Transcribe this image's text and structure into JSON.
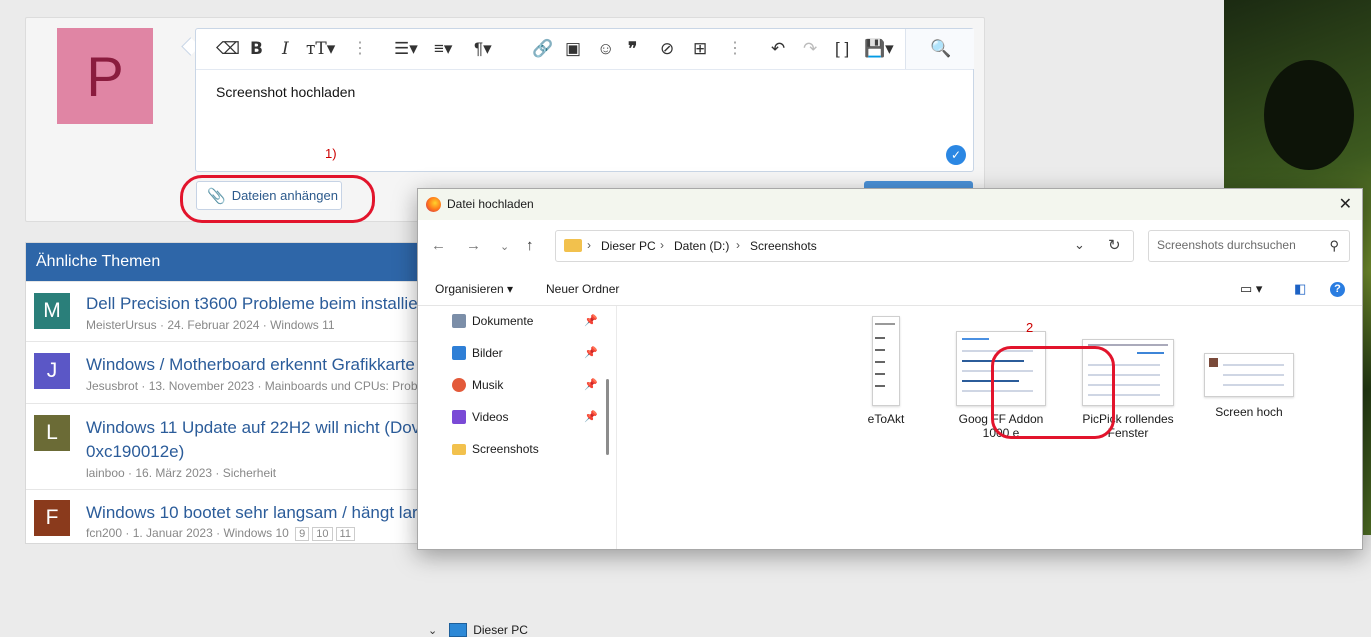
{
  "composer": {
    "avatar_letter": "P",
    "editor_text": "Screenshot hochladen",
    "toolbar_icons": [
      "eraser-icon",
      "bold-icon",
      "italic-icon",
      "text-size-icon",
      "more-icon",
      "list-icon",
      "align-icon",
      "paragraph-icon",
      "more-icon",
      "link-icon",
      "image-icon",
      "smiley-icon",
      "quote-icon",
      "hide-icon",
      "table-icon",
      "more-icon",
      "undo-icon",
      "redo-icon",
      "code-icon",
      "save-draft-icon",
      "preview-icon"
    ],
    "step1_label": "1)",
    "attach_label": "Dateien anhängen"
  },
  "similar": {
    "heading": "Ähnliche Themen",
    "topics": [
      {
        "letter": "M",
        "color": "#2a7f7a",
        "title": "Dell Precision t3600 Probleme beim installier",
        "author": "MeisterUrsus",
        "date": "24. Februar 2024",
        "forum": "Windows 11"
      },
      {
        "letter": "J",
        "color": "#5b57c6",
        "title": "Windows / Motherboard erkennt Grafikkarte",
        "author": "Jesusbrot",
        "date": "13. November 2023",
        "forum": "Mainboards und CPUs: Problen"
      },
      {
        "letter": "L",
        "color": "#6b6b36",
        "title": "Windows 11 Update auf 22H2 will nicht (Dov",
        "title2": "0xc190012e)",
        "author": "lainboo",
        "date": "16. März 2023",
        "forum": "Sicherheit"
      },
      {
        "letter": "F",
        "color": "#8a3a1c",
        "title": "Windows 10 bootet sehr langsam / hängt lar",
        "author": "fcn200",
        "date": "1. Januar 2023",
        "forum": "Windows 10",
        "pages": [
          "9",
          "10",
          "11"
        ]
      }
    ]
  },
  "dialog": {
    "title": "Datei hochladen",
    "path": [
      "Dieser PC",
      "Daten (D:)",
      "Screenshots"
    ],
    "search_placeholder": "Screenshots durchsuchen",
    "organize": "Organisieren",
    "new_folder": "Neuer Ordner",
    "nav_items": [
      {
        "label": "Dokumente",
        "icon": "documents-icon",
        "color": "#7b8ea8",
        "pinned": true
      },
      {
        "label": "Bilder",
        "icon": "pictures-icon",
        "color": "#2f7fd6",
        "pinned": true
      },
      {
        "label": "Musik",
        "icon": "music-icon",
        "color": "#e35a3a",
        "pinned": true
      },
      {
        "label": "Videos",
        "icon": "videos-icon",
        "color": "#7a4ad6",
        "pinned": true
      },
      {
        "label": "Screenshots",
        "icon": "folder-icon",
        "color": "#f2c14d",
        "pinned": false
      }
    ],
    "this_pc": "Dieser PC",
    "files": [
      {
        "name": "eToAkt"
      },
      {
        "name": "Goog FF Addon 1000 e"
      },
      {
        "name": "PicPick rollendes Fenster"
      },
      {
        "name": "Screen hoch"
      }
    ],
    "step2_label": "2"
  }
}
